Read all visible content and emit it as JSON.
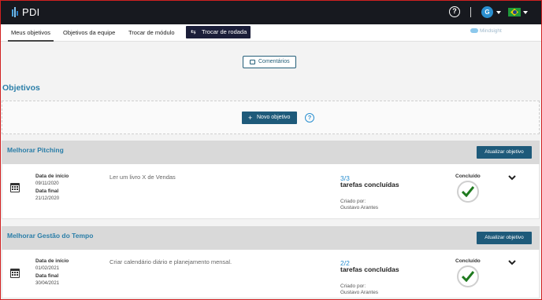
{
  "topbar": {
    "app_title": "PDI",
    "help_glyph": "?",
    "avatar_initial": "G",
    "language": "brazil-flag-icon"
  },
  "tabs": [
    {
      "label": "Meus objetivos",
      "active": true
    },
    {
      "label": "Objetivos da equipe",
      "active": false
    },
    {
      "label": "Trocar de módulo",
      "active": false
    }
  ],
  "switch_round": {
    "label": "Trocar de rodada",
    "icon": "swap-arrows-icon"
  },
  "brand": {
    "mindsight": "Mindsight"
  },
  "comments_button": "Comentários",
  "section_title": "Objetivos",
  "new_objective_button": "Novo objetivo",
  "help_glyph": "?",
  "objectives": [
    {
      "title": "Melhorar Pitching",
      "update_button": "Atualizar objetivo",
      "start_label": "Data de início",
      "start_date": "09/11/2020",
      "end_label": "Data final",
      "end_date": "21/12/2020",
      "description": "Ler um livro X de Vendas",
      "tasks_count": "3/3",
      "tasks_label": "tarefas concluídas",
      "created_by_label": "Criado por:",
      "created_by": "Gustavo Arantes",
      "status": "Concluído"
    },
    {
      "title": "Melhorar Gestão do Tempo",
      "update_button": "Atualizar objetivo",
      "start_label": "Data de início",
      "start_date": "01/02/2021",
      "end_label": "Data final",
      "end_date": "30/04/2021",
      "description": "Criar calendário diário e planejamento mensal.",
      "tasks_count": "2/2",
      "tasks_label": "tarefas concluídas",
      "created_by_label": "Criado por:",
      "created_by": "Gustavo Arantes",
      "status": "Concluído"
    }
  ],
  "colors": {
    "topbar": "#17191f",
    "accent_blue": "#2a7ea8",
    "button_dark_blue": "#1e5a7a",
    "switch_button": "#1b1e39",
    "check_green": "#1f7a1f"
  }
}
